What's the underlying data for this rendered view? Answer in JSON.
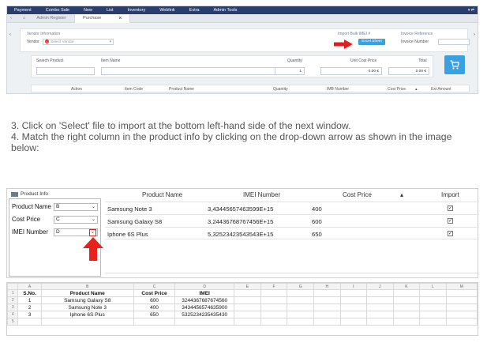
{
  "pos": {
    "menu": [
      "Payment",
      "Combo Sale",
      "New",
      "List",
      "Inventory",
      "Weblink",
      "Extra",
      "Admin Tools"
    ],
    "tabs": [
      "Admin Register",
      "Purchase"
    ],
    "vendor_info_label": "Vendor Information",
    "vendor_label": "Vendor",
    "vendor_placeholder": "Select Vendor",
    "import_label": "Import Bulk IMEI #",
    "import_button": "Excel Sheet",
    "invoice_ref_label": "Invoice Reference",
    "invoice_number_label": "Invoice Number",
    "search_product_label": "Search Product",
    "item_name_label": "Item Name",
    "quantity_label": "Quantity",
    "quantity_value": "1",
    "unit_cost_label": "Unit Cost Price",
    "unit_cost_value": "0.00 €",
    "total_label": "Total",
    "total_value": "0.00 €",
    "table_headers": [
      "Action",
      "Item Code",
      "Product Name",
      "Quantity",
      "IMB Number",
      "Cost Price",
      "Ext Amount"
    ]
  },
  "instructions": {
    "step3": "3. Click on 'Select' file to import at the bottom left-hand side of the next window.",
    "step4": "4. Match the right column in the product info by clicking on the drop-down arrow as shown in the image below:"
  },
  "product_info": {
    "title": "Product Info",
    "mappings": [
      {
        "label": "Product Name",
        "value": "B"
      },
      {
        "label": "Cost Price",
        "value": "C"
      },
      {
        "label": "IMEI Number",
        "value": "D"
      }
    ],
    "headers": [
      "Product Name",
      "IMEI Number",
      "Cost Price",
      "Import"
    ],
    "rows": [
      {
        "name": "Samsung Note 3",
        "imei": "3,43445657463599E+15",
        "cost": "400",
        "import": "✓"
      },
      {
        "name": "Samsung Galaxy S8",
        "imei": "3,24436768767456E+15",
        "cost": "600",
        "import": "✓"
      },
      {
        "name": "Iphone 6S Plus",
        "imei": "5,32523423543543E+15",
        "cost": "650",
        "import": "✓"
      }
    ]
  },
  "sheet": {
    "col_letters": [
      "A",
      "B",
      "C",
      "D",
      "E",
      "F",
      "G",
      "H",
      "I",
      "J",
      "K",
      "L",
      "M"
    ],
    "row_numbers": [
      "1",
      "2",
      "3",
      "4",
      "5"
    ],
    "header": [
      "S.No.",
      "Product Name",
      "Cost Price",
      "IMEI"
    ],
    "rows": [
      [
        "1",
        "Samsung Galaxy S8",
        "600",
        "3244367687674560"
      ],
      [
        "2",
        "Samsung Note 3",
        "400",
        "3434456574635900"
      ],
      [
        "3",
        "Iphone 6S Plus",
        "650",
        "5325234235435430"
      ]
    ]
  },
  "colors": {
    "menubar": "#2b3e6b",
    "accent_blue": "#3aa0e0",
    "highlight_red": "#e02020"
  },
  "icons": {
    "cart": "shopping-cart-icon",
    "arrow": "red-up-arrow",
    "dropdown": "chevron-down-icon"
  }
}
